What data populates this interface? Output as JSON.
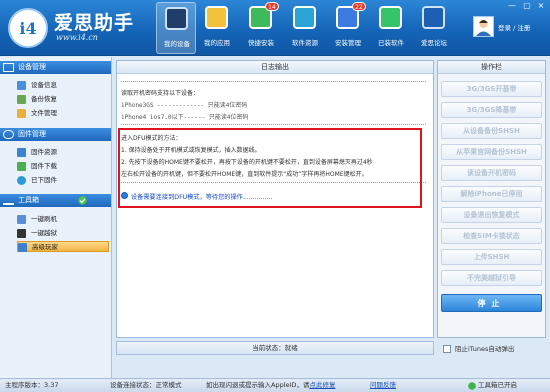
{
  "app": {
    "brand_name": "爱思助手",
    "brand_logo_text": "i4",
    "brand_url": "www.i4.cn"
  },
  "nav": [
    {
      "label": "我的设备",
      "icon": "phone-icon",
      "active": true
    },
    {
      "label": "我的应用",
      "icon": "apps-icon"
    },
    {
      "label": "快捷安装",
      "icon": "install-icon",
      "badge": "14"
    },
    {
      "label": "软件资源",
      "icon": "software-icon"
    },
    {
      "label": "安装管理",
      "icon": "manage-icon",
      "badge": "22"
    },
    {
      "label": "已装软件",
      "icon": "installed-icon"
    },
    {
      "label": "爱思论坛",
      "icon": "forum-icon"
    }
  ],
  "user": {
    "login_text": "登录 / 注册"
  },
  "window_controls": [
    "—",
    "▢",
    "×"
  ],
  "sidebar": {
    "sections": [
      {
        "title": "设备管理",
        "icon": "monitor-icon",
        "items": [
          "设备信息",
          "备份恢复",
          "文件管理"
        ]
      },
      {
        "title": "固件管理",
        "icon": "firmware-icon",
        "items": [
          "固件资源",
          "固件下载",
          "已下固件"
        ]
      },
      {
        "title": "工具箱",
        "icon": "tools-icon",
        "items": [
          "一键刷机",
          "一键越狱",
          "高级玩家"
        ],
        "selected": "高级玩家"
      }
    ]
  },
  "log": {
    "title": "日志输出",
    "lines_top": [
      "读取开机密码支持以下设备：",
      "iPhone3GS ------------- 只能读4位密码",
      "iPhone4  ios7.0以下------ 只能读4位密码"
    ],
    "dfu_lines": [
      "进入DFU模式的方法：",
      "1. 保持设备处于开机模式或恢复模式，插入数据线。",
      "2. 先按下设备的HOME键不要松开，再按下设备的开机键不要松开，直到设备屏幕熄灭再过4秒",
      "   左右松开设备的开机键，但不要松开HOME键，直到软件提示“成功”字样再将HOME键松开。"
    ],
    "status": "设备需要连接到DFU模式，等待您的操作..............."
  },
  "progress_label": "当前状态：就绪",
  "ops": {
    "title": "操作栏",
    "buttons": [
      "3G/3GS开基带",
      "3G/3GS降基带",
      "从设备备份SHSH",
      "从苹果官网备份SHSH",
      "读设备开机密码",
      "解除iPhone已停用",
      "设备退出恢复模式",
      "检查SIM卡锁状态",
      "上传SHSH",
      "不完美越狱引导"
    ],
    "stop_button": "停止"
  },
  "itunes_checkbox": "阻止iTunes自动弹出",
  "statusbar": {
    "version": "主程序版本：3.37",
    "connection": "设备连接状态：正常模式",
    "tip_prefix": "如出现闪退或提示输入AppleID，请",
    "tip_link": "点此修复",
    "feedback": "问题反馈",
    "update": "工具箱已开启"
  },
  "colors": {
    "header_blue": "#1565b8",
    "highlight_red": "#e0141b",
    "status_blue": "#1247c6",
    "selected_orange": "#f4b643"
  }
}
